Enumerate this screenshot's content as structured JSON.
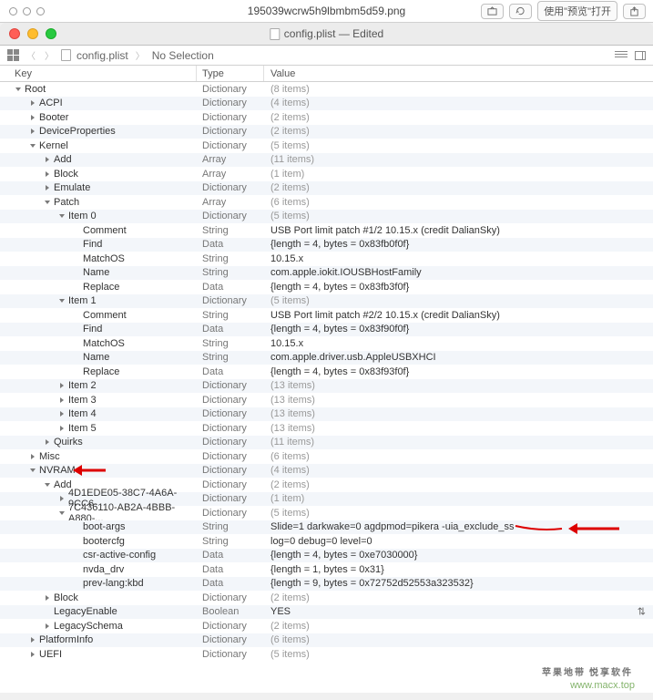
{
  "finder": {
    "title": "195039wcrw5h9lbmbm5d59.png",
    "open_btn": "使用\"预览\"打开"
  },
  "window": {
    "title": "config.plist — Edited"
  },
  "path": {
    "file": "config.plist",
    "selection": "No Selection"
  },
  "headers": {
    "key": "Key",
    "type": "Type",
    "value": "Value"
  },
  "types": {
    "dict": "Dictionary",
    "arr": "Array",
    "str": "String",
    "data": "Data",
    "bool": "Boolean"
  },
  "vals": {
    "items8": "(8 items)",
    "items4": "(4 items)",
    "items2": "(2 items)",
    "items5": "(5 items)",
    "items11": "(11 items)",
    "items1": "(1 item)",
    "items6": "(6 items)",
    "items13": "(13 items)",
    "usb1": "USB Port limit patch #1/2 10.15.x (credit DalianSky)",
    "find1": "{length = 4, bytes = 0x83fb0f0f}",
    "v10": "10.15.x",
    "name1": "com.apple.iokit.IOUSBHostFamily",
    "rep1": "{length = 4, bytes = 0x83fb3f0f}",
    "usb2": "USB Port limit patch #2/2 10.15.x (credit DalianSky)",
    "find2": "{length = 4, bytes = 0x83f90f0f}",
    "name2": "com.apple.driver.usb.AppleUSBXHCI",
    "rep2": "{length = 4, bytes = 0x83f93f0f}",
    "bootargs": "Slide=1 darkwake=0 agdpmod=pikera -uia_exclude_ss",
    "bootercfg": "log=0 debug=0 level=0",
    "csr": "{length = 4, bytes = 0xe7030000}",
    "nvda": "{length = 1, bytes = 0x31}",
    "prev": "{length = 9, bytes = 0x72752d52553a323532}",
    "yes": "YES"
  },
  "rows": [
    {
      "d": 0,
      "o": "down",
      "k": "Root",
      "t": "dict",
      "v": "items8",
      "dim": 1
    },
    {
      "d": 1,
      "o": "right",
      "k": "ACPI",
      "t": "dict",
      "v": "items4",
      "dim": 1
    },
    {
      "d": 1,
      "o": "right",
      "k": "Booter",
      "t": "dict",
      "v": "items2",
      "dim": 1
    },
    {
      "d": 1,
      "o": "right",
      "k": "DeviceProperties",
      "t": "dict",
      "v": "items2",
      "dim": 1
    },
    {
      "d": 1,
      "o": "down",
      "k": "Kernel",
      "t": "dict",
      "v": "items5",
      "dim": 1
    },
    {
      "d": 2,
      "o": "right",
      "k": "Add",
      "t": "arr",
      "v": "items11",
      "dim": 1
    },
    {
      "d": 2,
      "o": "right",
      "k": "Block",
      "t": "arr",
      "v": "items1",
      "dim": 1
    },
    {
      "d": 2,
      "o": "right",
      "k": "Emulate",
      "t": "dict",
      "v": "items2",
      "dim": 1
    },
    {
      "d": 2,
      "o": "down",
      "k": "Patch",
      "t": "arr",
      "v": "items6",
      "dim": 1
    },
    {
      "d": 3,
      "o": "down",
      "k": "Item 0",
      "t": "dict",
      "v": "items5",
      "dim": 1
    },
    {
      "d": 4,
      "o": "",
      "k": "Comment",
      "t": "str",
      "v": "usb1"
    },
    {
      "d": 4,
      "o": "",
      "k": "Find",
      "t": "data",
      "v": "find1"
    },
    {
      "d": 4,
      "o": "",
      "k": "MatchOS",
      "t": "str",
      "v": "v10"
    },
    {
      "d": 4,
      "o": "",
      "k": "Name",
      "t": "str",
      "v": "name1"
    },
    {
      "d": 4,
      "o": "",
      "k": "Replace",
      "t": "data",
      "v": "rep1"
    },
    {
      "d": 3,
      "o": "down",
      "k": "Item 1",
      "t": "dict",
      "v": "items5",
      "dim": 1
    },
    {
      "d": 4,
      "o": "",
      "k": "Comment",
      "t": "str",
      "v": "usb2"
    },
    {
      "d": 4,
      "o": "",
      "k": "Find",
      "t": "data",
      "v": "find2"
    },
    {
      "d": 4,
      "o": "",
      "k": "MatchOS",
      "t": "str",
      "v": "v10"
    },
    {
      "d": 4,
      "o": "",
      "k": "Name",
      "t": "str",
      "v": "name2"
    },
    {
      "d": 4,
      "o": "",
      "k": "Replace",
      "t": "data",
      "v": "rep2"
    },
    {
      "d": 3,
      "o": "right",
      "k": "Item 2",
      "t": "dict",
      "v": "items13",
      "dim": 1
    },
    {
      "d": 3,
      "o": "right",
      "k": "Item 3",
      "t": "dict",
      "v": "items13",
      "dim": 1
    },
    {
      "d": 3,
      "o": "right",
      "k": "Item 4",
      "t": "dict",
      "v": "items13",
      "dim": 1
    },
    {
      "d": 3,
      "o": "right",
      "k": "Item 5",
      "t": "dict",
      "v": "items13",
      "dim": 1
    },
    {
      "d": 2,
      "o": "right",
      "k": "Quirks",
      "t": "dict",
      "v": "items11",
      "dim": 1
    },
    {
      "d": 1,
      "o": "right",
      "k": "Misc",
      "t": "dict",
      "v": "items6",
      "dim": 1
    },
    {
      "d": 1,
      "o": "down",
      "k": "NVRAM",
      "t": "dict",
      "v": "items4",
      "dim": 1,
      "arrow1": 1
    },
    {
      "d": 2,
      "o": "down",
      "k": "Add",
      "t": "dict",
      "v": "items2",
      "dim": 1
    },
    {
      "d": 3,
      "o": "right",
      "k": "4D1EDE05-38C7-4A6A-9CC6-...",
      "t": "dict",
      "v": "items1",
      "dim": 1
    },
    {
      "d": 3,
      "o": "down",
      "k": "7C436110-AB2A-4BBB-A880-...",
      "t": "dict",
      "v": "items5",
      "dim": 1
    },
    {
      "d": 4,
      "o": "",
      "k": "boot-args",
      "t": "str",
      "v": "bootargs",
      "arrow2": 1
    },
    {
      "d": 4,
      "o": "",
      "k": "bootercfg",
      "t": "str",
      "v": "bootercfg"
    },
    {
      "d": 4,
      "o": "",
      "k": "csr-active-config",
      "t": "data",
      "v": "csr"
    },
    {
      "d": 4,
      "o": "",
      "k": "nvda_drv",
      "t": "data",
      "v": "nvda"
    },
    {
      "d": 4,
      "o": "",
      "k": "prev-lang:kbd",
      "t": "data",
      "v": "prev"
    },
    {
      "d": 2,
      "o": "right",
      "k": "Block",
      "t": "dict",
      "v": "items2",
      "dim": 1
    },
    {
      "d": 2,
      "o": "",
      "k": "LegacyEnable",
      "t": "bool",
      "v": "yes",
      "sep": 1
    },
    {
      "d": 2,
      "o": "right",
      "k": "LegacySchema",
      "t": "dict",
      "v": "items2",
      "dim": 1
    },
    {
      "d": 1,
      "o": "right",
      "k": "PlatformInfo",
      "t": "dict",
      "v": "items6",
      "dim": 1
    },
    {
      "d": 1,
      "o": "right",
      "k": "UEFI",
      "t": "dict",
      "v": "items5",
      "dim": 1
    }
  ],
  "watermark": {
    "l1": "苹果地带",
    "l1b": "悦享软件",
    "l2": "www.macx.top"
  }
}
